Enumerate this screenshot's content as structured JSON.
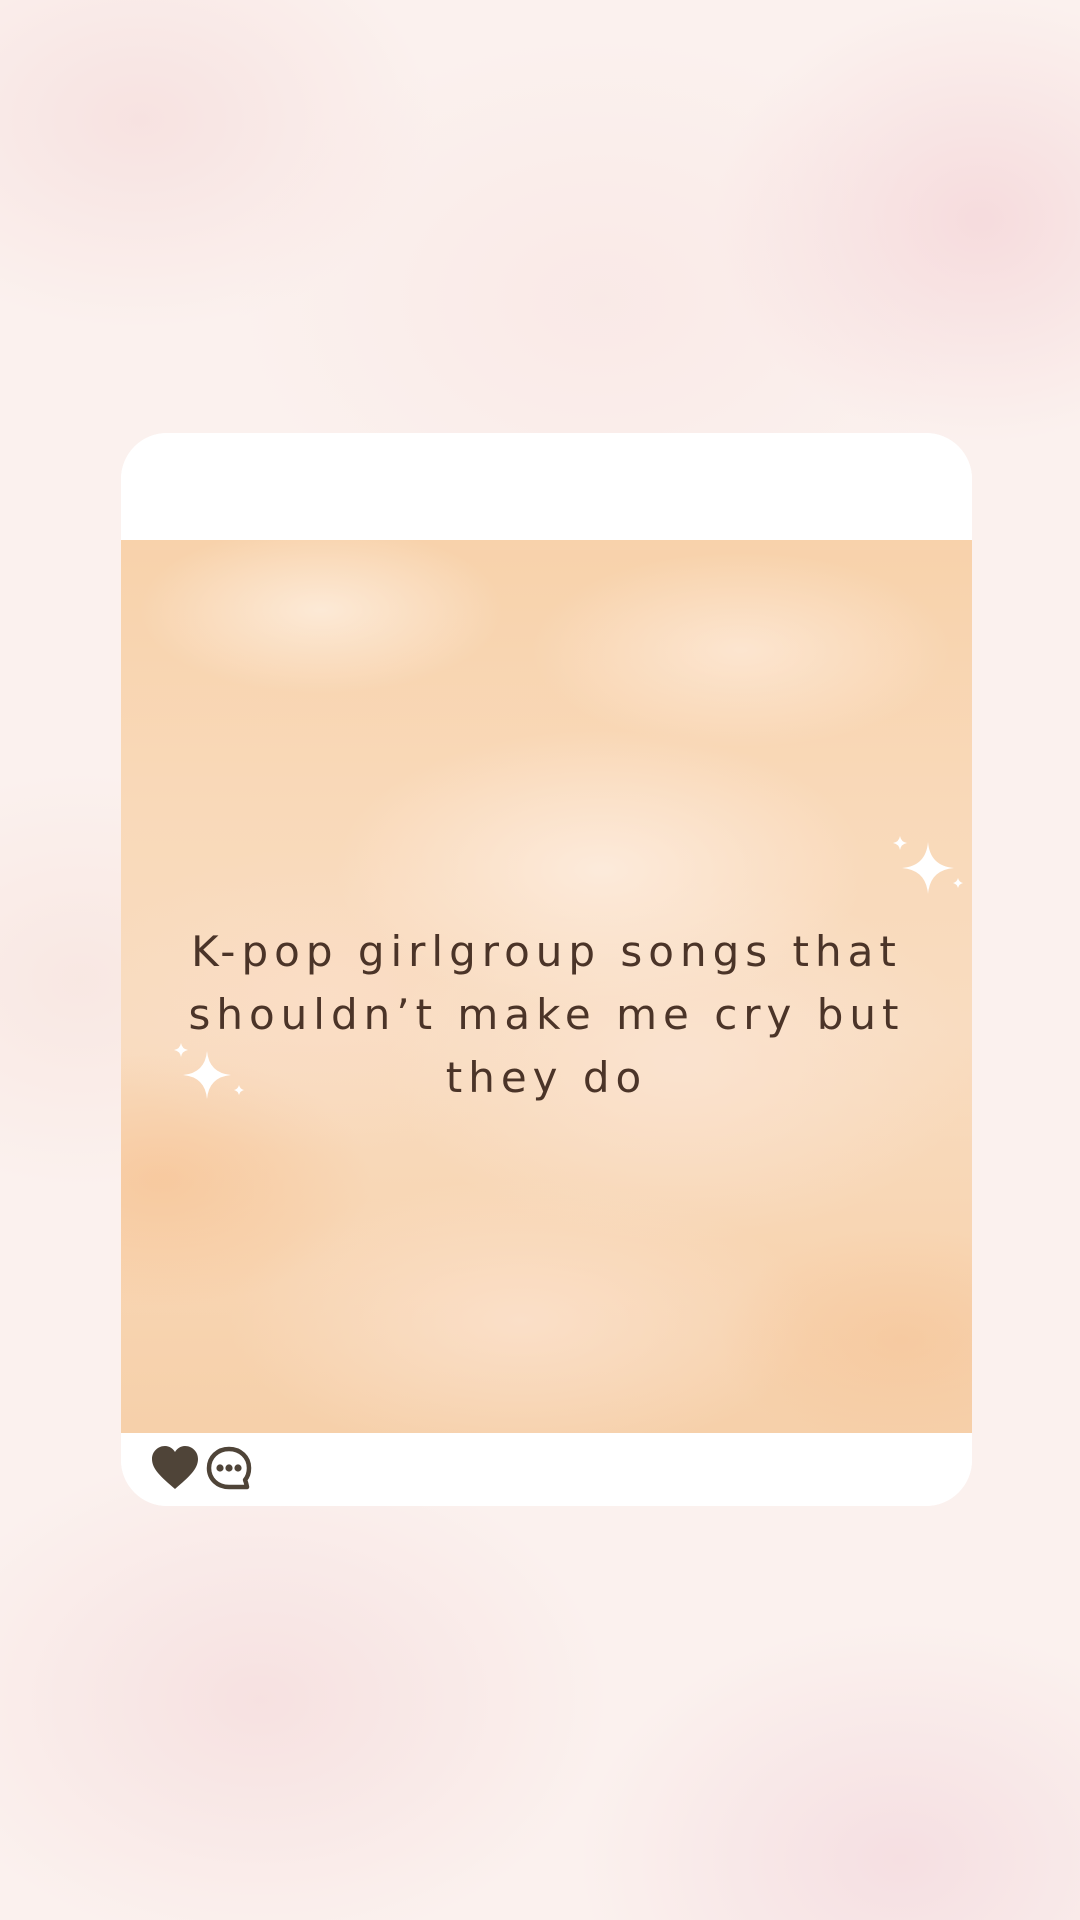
{
  "post": {
    "text": "K-pop girlgroup songs that shouldn’t make me cry but they do",
    "actions": {
      "like_icon": "heart-icon",
      "comment_icon": "comment-icon"
    }
  },
  "colors": {
    "text": "#4b3428",
    "icons": "#4f4438",
    "card": "#ffffff",
    "image_tone": "#f9d9b9"
  }
}
